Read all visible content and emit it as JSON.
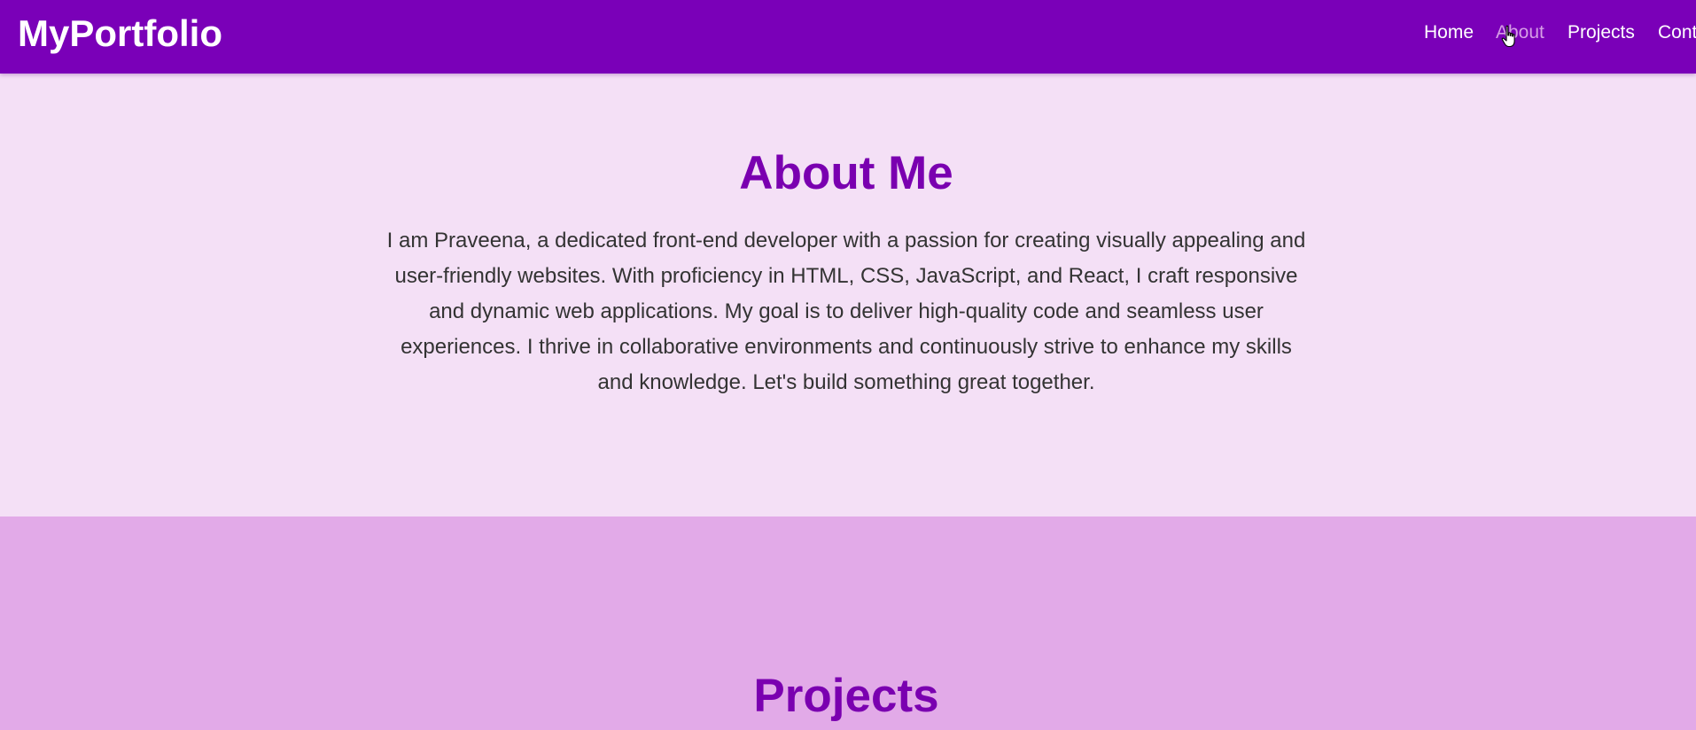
{
  "navbar": {
    "brand": "MyPortfolio",
    "links": [
      {
        "label": "Home"
      },
      {
        "label": "About",
        "state": "hover"
      },
      {
        "label": "Projects"
      },
      {
        "label": "Cont"
      }
    ]
  },
  "about": {
    "title": "About Me",
    "text": "I am Praveena, a dedicated front-end developer with a passion for creating visually appealing and user-friendly websites. With proficiency in HTML, CSS, JavaScript, and React, I craft responsive and dynamic web applications. My goal is to deliver high-quality code and seamless user experiences. I thrive in collaborative environments and continuously strive to enhance my skills and knowledge. Let's build something great together."
  },
  "projects": {
    "title": "Projects"
  },
  "colors": {
    "navbar_bg": "#7a00b8",
    "heading": "#7a00b0",
    "about_bg": "#f4e0f6",
    "projects_bg": "#e2aae8",
    "link_hover": "#d69ee6"
  },
  "icons": {
    "cursor": "hand-pointer-cursor-icon"
  }
}
